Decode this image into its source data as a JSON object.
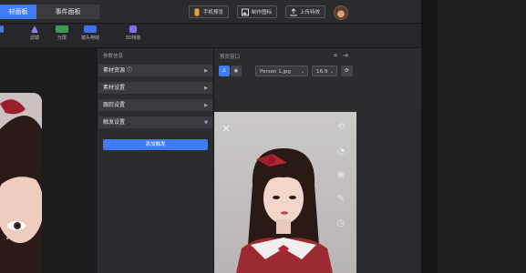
{
  "tabs": [
    {
      "label": "材面板"
    },
    {
      "label": "事件面板"
    }
  ],
  "top_buttons": [
    {
      "label": "手机预览",
      "icon": "phone-icon"
    },
    {
      "label": "制作图标",
      "icon": "image-icon"
    },
    {
      "label": "上传特效",
      "icon": "upload-icon"
    }
  ],
  "toolbar": [
    {
      "label": "滤镜",
      "icon": "filter-icon"
    },
    {
      "label": "分屏",
      "icon": "split-screen-icon"
    },
    {
      "label": "镜头特效",
      "icon": "lens-effect-icon"
    },
    {
      "label": "3D特效",
      "icon": "3d-effect-icon"
    }
  ],
  "params": {
    "title": "参数信息",
    "rows": [
      {
        "label": "素材资源 ⓘ"
      },
      {
        "label": "素材设置"
      },
      {
        "label": "跟踪设置"
      },
      {
        "label": "触发设置"
      }
    ],
    "add_trigger": "添加触发"
  },
  "preview": {
    "title": "预览窗口",
    "file_select": "Person 1.jpg",
    "ratio_select": "16:9"
  },
  "colors": {
    "accent": "#3d7cf5",
    "background": "#1e1e20",
    "panel": "#2b2c30"
  }
}
